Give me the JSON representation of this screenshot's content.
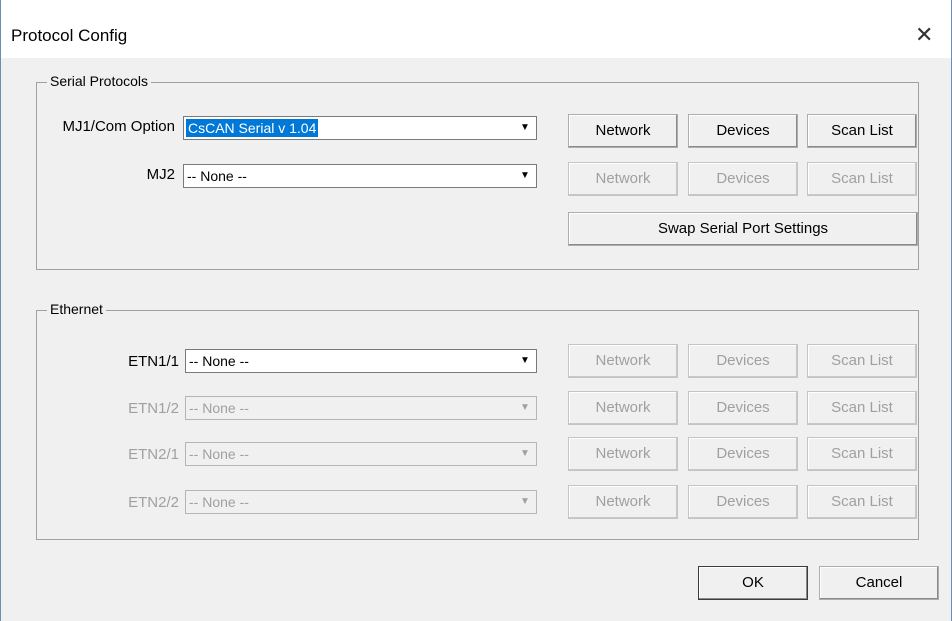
{
  "window": {
    "title": "Protocol Config",
    "close_glyph": "✕"
  },
  "serial": {
    "legend": "Serial Protocols",
    "rows": [
      {
        "label": "MJ1/Com Option",
        "value": "CsCAN Serial  v 1.04",
        "enabled": true
      },
      {
        "label": "MJ2",
        "value": "-- None --",
        "enabled": true
      }
    ],
    "buttons": {
      "network": "Network",
      "devices": "Devices",
      "scan_list": "Scan List"
    },
    "swap_label": "Swap Serial Port Settings"
  },
  "ethernet": {
    "legend": "Ethernet",
    "rows": [
      {
        "label": "ETN1/1",
        "value": "-- None --",
        "enabled": true
      },
      {
        "label": "ETN1/2",
        "value": "-- None --",
        "enabled": false
      },
      {
        "label": "ETN2/1",
        "value": "-- None --",
        "enabled": false
      },
      {
        "label": "ETN2/2",
        "value": "-- None --",
        "enabled": false
      }
    ],
    "buttons": {
      "network": "Network",
      "devices": "Devices",
      "scan_list": "Scan List"
    }
  },
  "footer": {
    "ok_label": "OK",
    "cancel_label": "Cancel"
  },
  "icons": {
    "dropdown": "dropdown-arrow-icon",
    "close": "close-icon"
  }
}
